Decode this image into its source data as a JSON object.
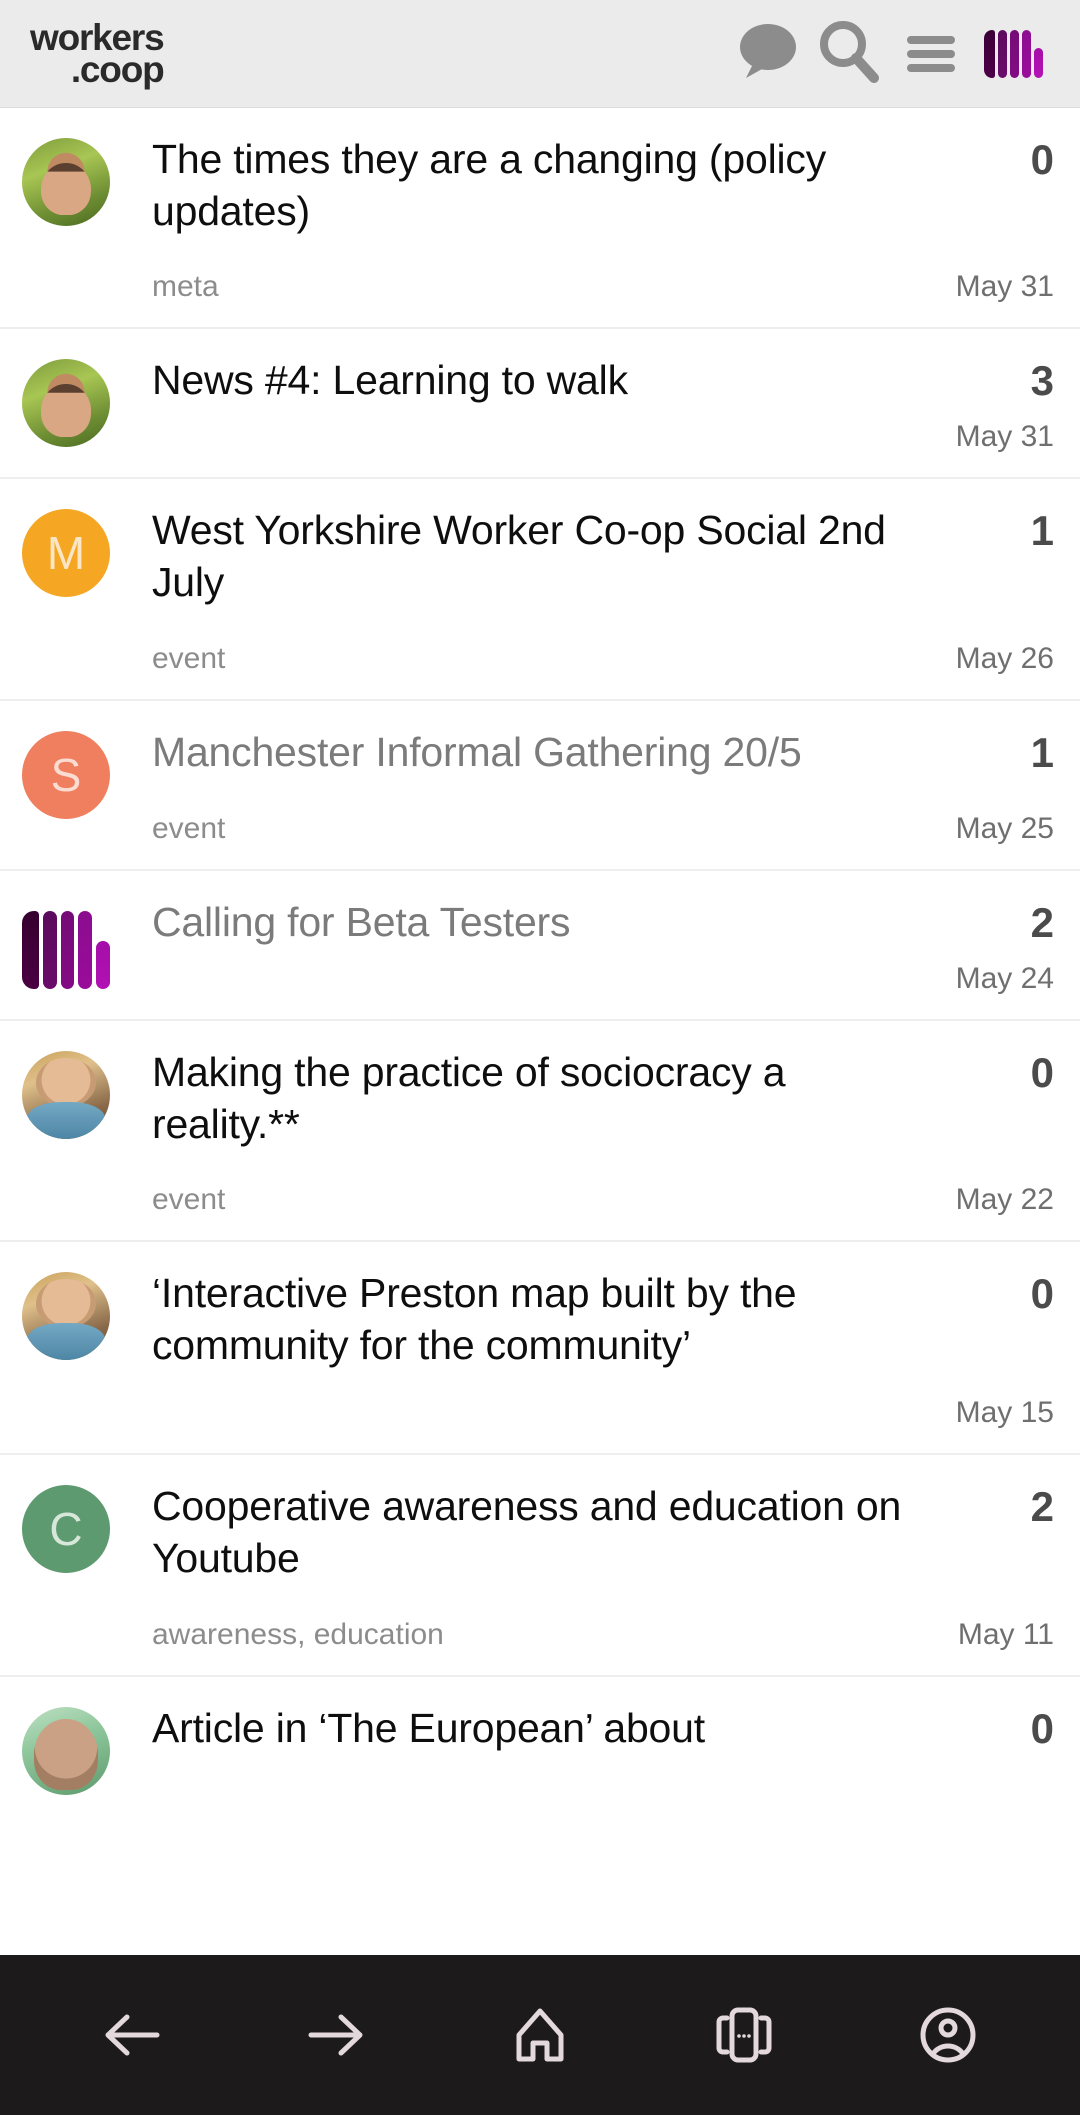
{
  "header": {
    "brand_line1": "workers",
    "brand_line2": ".coop",
    "icons": {
      "chat": "chat-bubble-icon",
      "search": "search-icon",
      "menu": "hamburger-menu-icon",
      "logo": "workers-coop-bars-icon"
    }
  },
  "topics": [
    {
      "avatar_type": "photo-a",
      "avatar_letter": "",
      "title": "The times they are a changing (policy updates)",
      "visited": false,
      "replies": "0",
      "tags": "meta",
      "date": "May 31"
    },
    {
      "avatar_type": "photo-a",
      "avatar_letter": "",
      "title": "News #4: Learning to walk",
      "visited": false,
      "replies": "3",
      "tags": "",
      "date": "May 31"
    },
    {
      "avatar_type": "letter",
      "avatar_letter": "M",
      "avatar_bg": "#f5a623",
      "avatar_fg": "#fae6c4",
      "title": "West Yorkshire Worker Co-op Social 2nd July",
      "visited": false,
      "replies": "1",
      "tags": "event",
      "date": "May 26"
    },
    {
      "avatar_type": "letter",
      "avatar_letter": "S",
      "avatar_bg": "#ef7f5e",
      "avatar_fg": "#fbdcd2",
      "title": "Manchester Informal Gathering 20/5",
      "visited": true,
      "replies": "1",
      "tags": "event",
      "date": "May 25"
    },
    {
      "avatar_type": "coop-bars",
      "avatar_letter": "",
      "title": "Calling for Beta Testers",
      "visited": true,
      "replies": "2",
      "tags": "",
      "date": "May 24"
    },
    {
      "avatar_type": "photo-b",
      "avatar_letter": "",
      "title": "Making the practice of sociocracy a reality.**",
      "visited": false,
      "replies": "0",
      "tags": "event",
      "date": "May 22"
    },
    {
      "avatar_type": "photo-b",
      "avatar_letter": "",
      "title": "‘Interactive Preston map built by the community for the community’",
      "visited": false,
      "replies": "0",
      "tags": "",
      "date": "May 15"
    },
    {
      "avatar_type": "letter",
      "avatar_letter": "C",
      "avatar_bg": "#5e9a6f",
      "avatar_fg": "#d7e8da",
      "title": "Cooperative awareness and education on Youtube",
      "visited": false,
      "replies": "2",
      "tags": "awareness,  education",
      "date": "May 11"
    },
    {
      "avatar_type": "photo-c",
      "avatar_letter": "",
      "title": "Article in ‘The European’ about",
      "visited": false,
      "replies": "0",
      "tags": "",
      "date": ""
    }
  ],
  "bottom_nav": {
    "items": [
      {
        "name": "back-arrow-icon",
        "label": "Back"
      },
      {
        "name": "forward-arrow-icon",
        "label": "Forward"
      },
      {
        "name": "home-icon",
        "label": "Home"
      },
      {
        "name": "tabs-icon",
        "label": "Tabs"
      },
      {
        "name": "account-icon",
        "label": "Account"
      }
    ]
  },
  "colors": {
    "header_bg": "#ebebeb",
    "brand_fg": "#2a2a2a",
    "icon_gray": "#8c8c8c",
    "title_fg": "#0e0e0e",
    "visited_fg": "#7b7b7b",
    "meta_fg": "#8c8c8c",
    "nav_bg": "#1c1a1b",
    "nav_fg": "#e3d8dc",
    "brand_purple": "#8b0c8f"
  }
}
